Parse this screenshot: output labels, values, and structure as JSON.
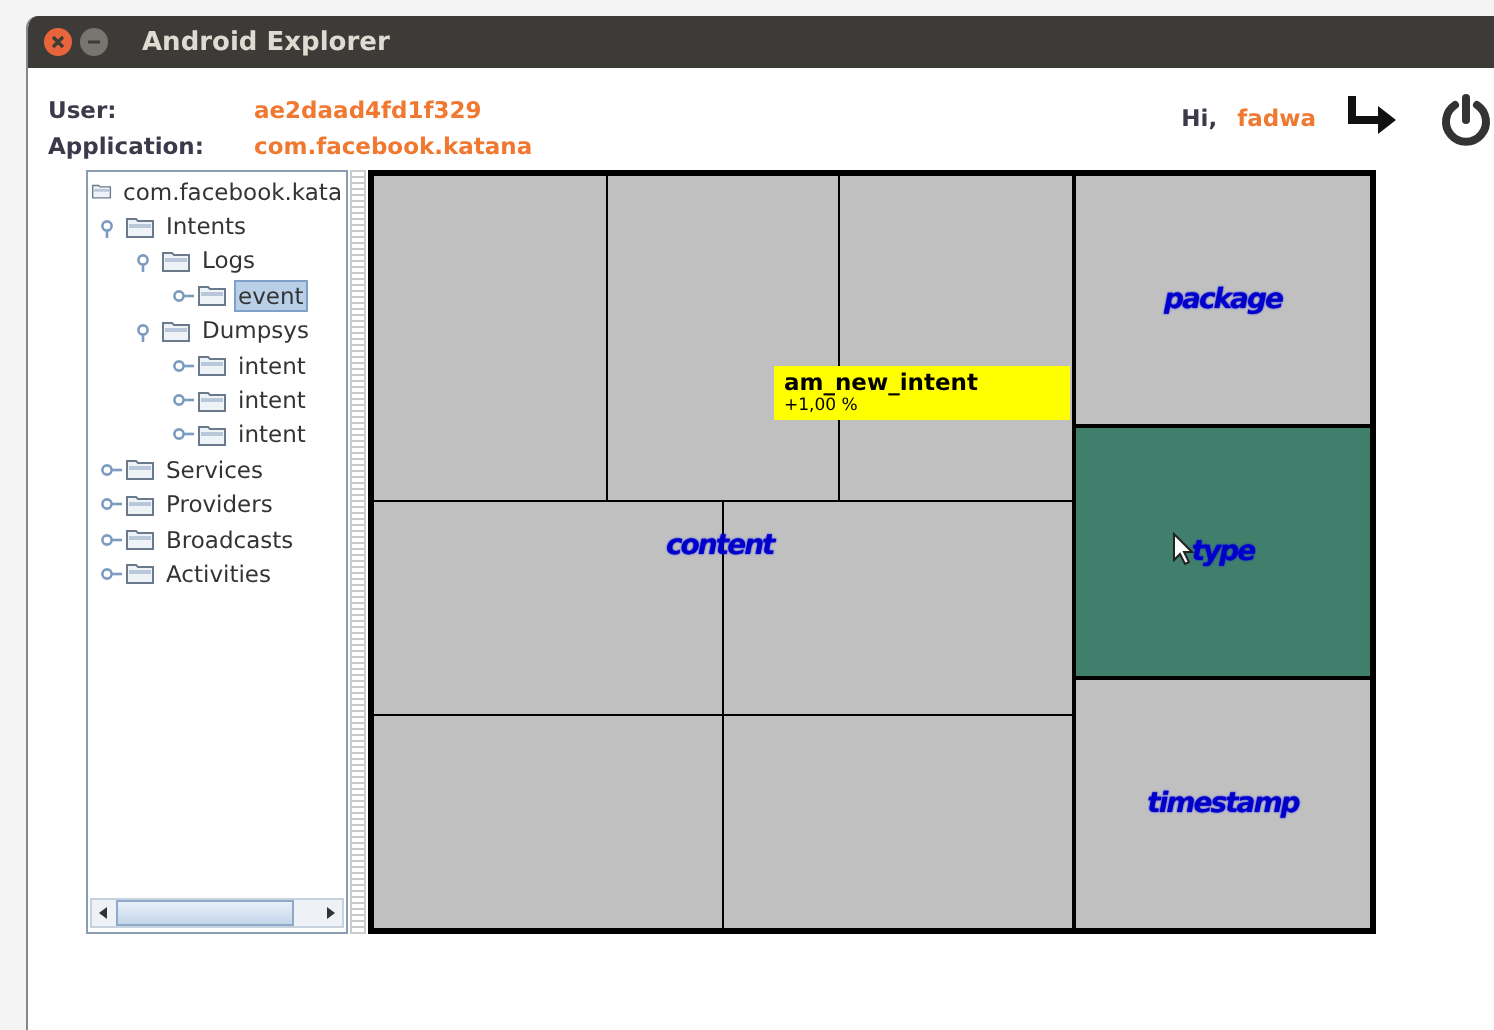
{
  "window": {
    "title": "Android Explorer"
  },
  "header": {
    "user_label": "User:",
    "user_value": "ae2daad4fd1f329",
    "application_label": "Application:",
    "application_value": "com.facebook.katana",
    "greeting": "Hi,",
    "username": "fadwa"
  },
  "tree": {
    "label": "com.facebook.kata",
    "children": [
      {
        "label": "Intents",
        "expanded": true,
        "selected": false,
        "children": [
          {
            "label": "Logs",
            "expanded": true,
            "selected": false,
            "children": [
              {
                "label": "event",
                "expanded": false,
                "selected": true
              }
            ]
          },
          {
            "label": "Dumpsys",
            "expanded": true,
            "selected": false,
            "children": [
              {
                "label": "intent",
                "expanded": false,
                "selected": false
              },
              {
                "label": "intent",
                "expanded": false,
                "selected": false
              },
              {
                "label": "intent",
                "expanded": false,
                "selected": false
              }
            ]
          }
        ]
      },
      {
        "label": "Services",
        "expanded": false,
        "selected": false
      },
      {
        "label": "Providers",
        "expanded": false,
        "selected": false
      },
      {
        "label": "Broadcasts",
        "expanded": false,
        "selected": false
      },
      {
        "label": "Activities",
        "expanded": false,
        "selected": false
      }
    ]
  },
  "treemap": {
    "main_label": "content",
    "side_cells": [
      {
        "label": "package",
        "selected": false
      },
      {
        "label": "type",
        "selected": true
      },
      {
        "label": "timestamp",
        "selected": false
      }
    ],
    "tooltip": {
      "title": "am_new_intent",
      "value": "+1,00 %"
    }
  }
}
